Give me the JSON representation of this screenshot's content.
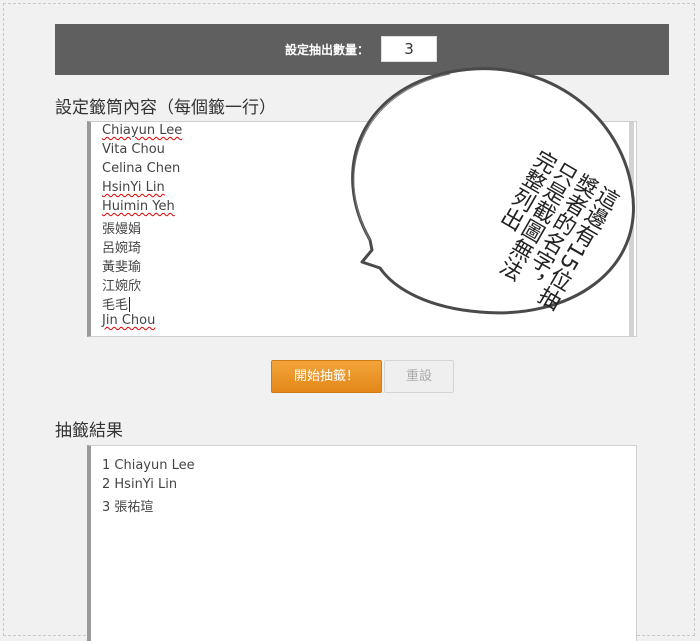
{
  "header": {
    "count_label": "設定抽出數量：",
    "count_value": "3"
  },
  "entries": {
    "heading": "設定籤筒內容（每個籤一行）",
    "names": [
      "Chiayun Lee",
      "Vita Chou",
      "Celina Chen",
      "HsinYi Lin",
      "Huimin Yeh",
      "張嫚娟",
      "呂婉琦",
      "黃斐瑜",
      "江婉欣",
      "毛毛",
      "Jin Chou"
    ]
  },
  "actions": {
    "start_label": "開始抽籤！",
    "reset_label": "重設"
  },
  "results": {
    "heading": "抽籤結果",
    "lines": [
      "1 Chiayun Lee",
      "2 HsinYi Lin",
      "3 張祐瑄"
    ]
  },
  "annotation": {
    "callout_text": "這邊有15位抽獎者的名字，只是截圖無法完整列出"
  }
}
